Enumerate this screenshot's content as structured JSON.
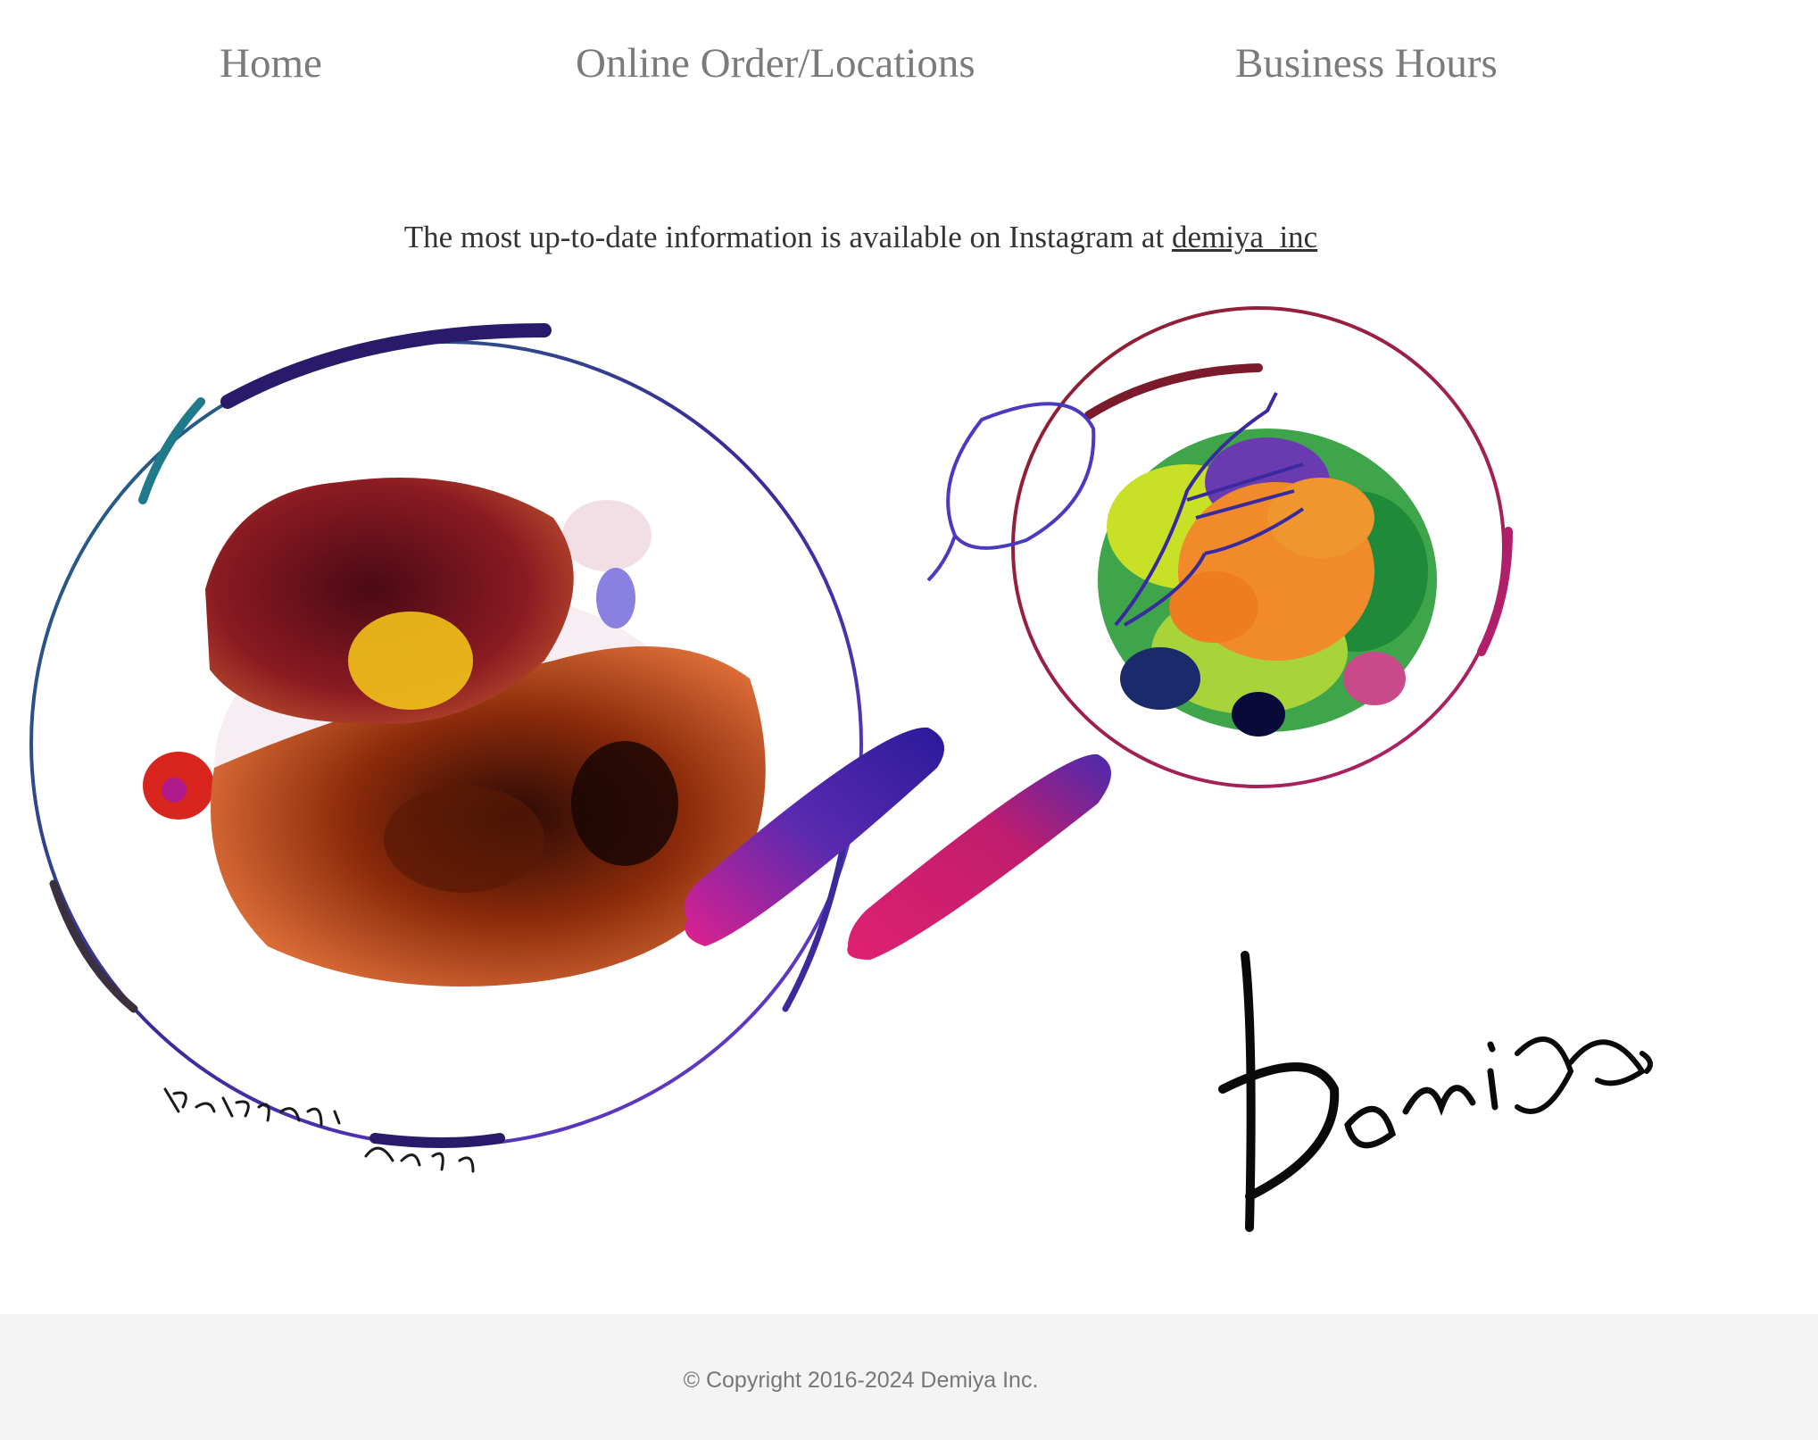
{
  "nav": {
    "home": "Home",
    "order": "Online Order/Locations",
    "hours": "Business Hours"
  },
  "notice": {
    "text": "The most up-to-date information is available on Instagram at ",
    "link": "demiya_inc"
  },
  "illustration": {
    "artist_signature": "Katsumi Yada.",
    "brand_signature": "Demiya",
    "icons": [
      "curry-plate-icon",
      "salad-plate-icon",
      "spoon-icon",
      "fork-icon"
    ]
  },
  "footer": {
    "copyright": "© Copyright 2016-2024 Demiya Inc."
  },
  "colors": {
    "nav_text": "#7b7b7b",
    "body_text": "#333333",
    "footer_bg": "#f4f4f4",
    "footer_text": "#777777"
  }
}
